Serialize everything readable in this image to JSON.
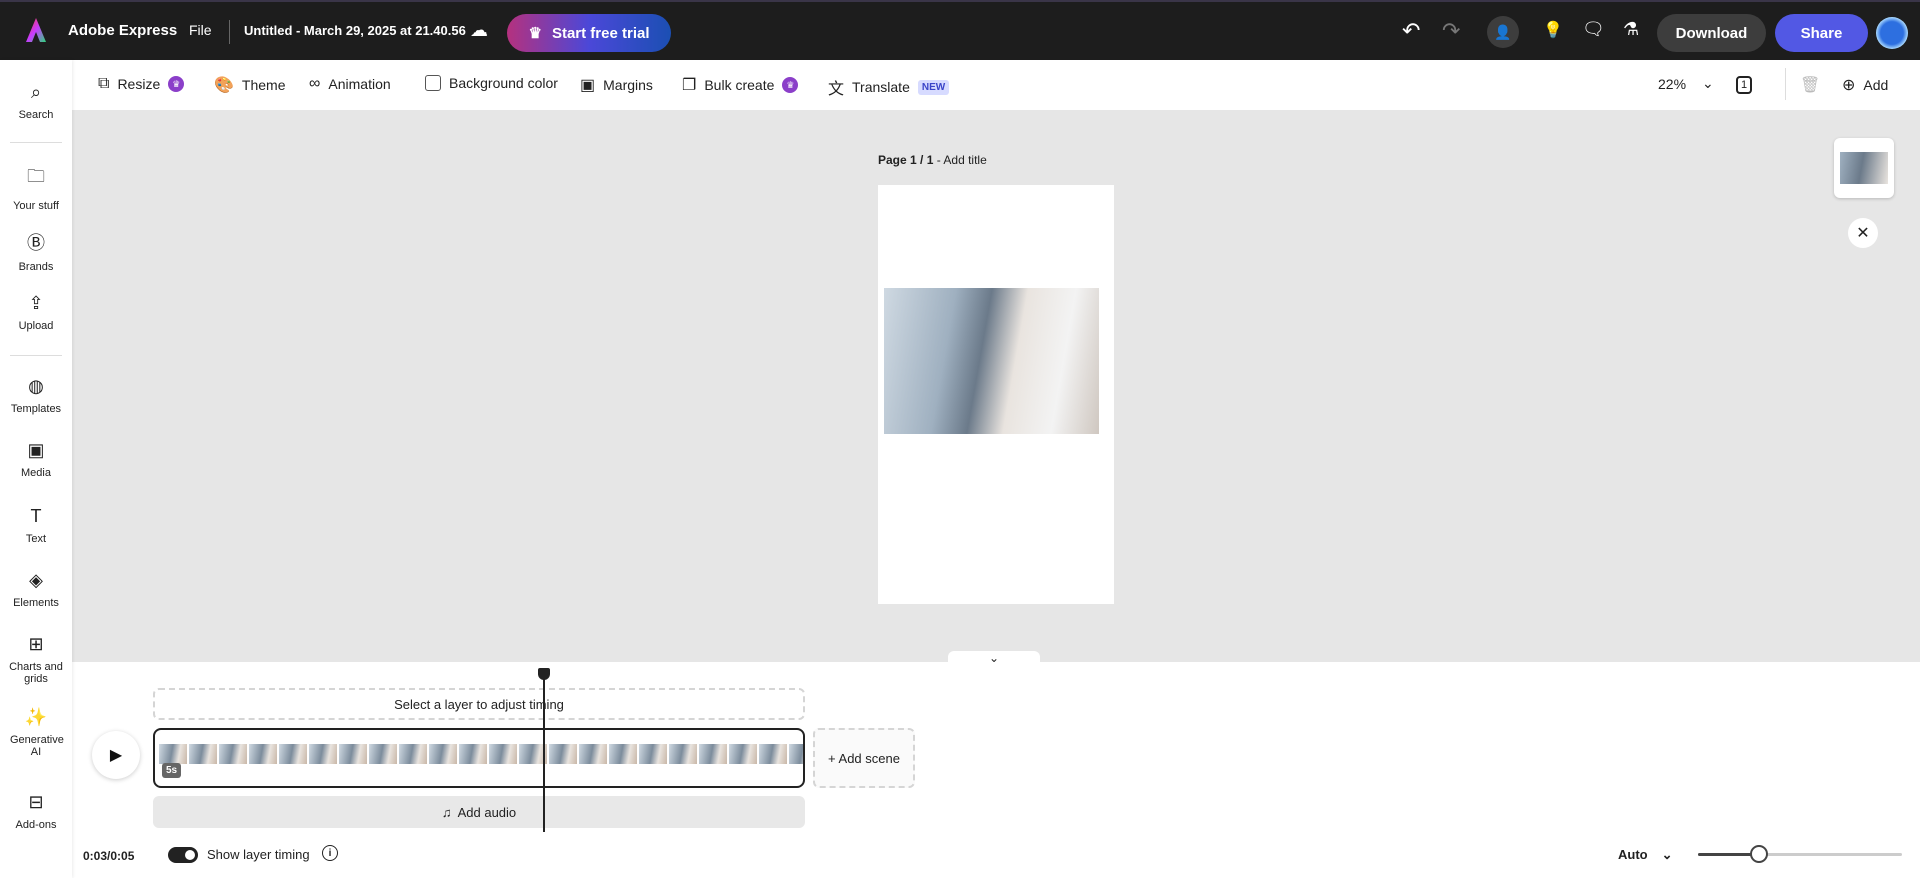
{
  "topbar": {
    "app_name": "Adobe Express",
    "file_menu": "File",
    "doc_title": "Untitled - March 29, 2025 at 21.40.56",
    "trial_label": "Start free trial",
    "download_label": "Download",
    "share_label": "Share"
  },
  "toolbar": {
    "items": [
      {
        "label": "Resize"
      },
      {
        "label": "Theme"
      },
      {
        "label": "Animation"
      },
      {
        "label": "Background color"
      },
      {
        "label": "Margins"
      },
      {
        "label": "Bulk create"
      },
      {
        "label": "Translate",
        "badge": "NEW"
      }
    ],
    "zoom": "22%",
    "page_count": "1",
    "add_label": "Add"
  },
  "sidebar": {
    "items": [
      {
        "label": "Search"
      },
      {
        "label": "Your stuff"
      },
      {
        "label": "Brands"
      },
      {
        "label": "Upload"
      },
      {
        "label": "Templates"
      },
      {
        "label": "Media"
      },
      {
        "label": "Text"
      },
      {
        "label": "Elements"
      },
      {
        "label": "Charts and grids"
      },
      {
        "label": "Generative AI"
      },
      {
        "label": "Add-ons"
      }
    ]
  },
  "canvas": {
    "page_label": "Page 1 / 1",
    "page_title_link": "- Add title"
  },
  "timeline": {
    "select_hint": "Select a layer to adjust timing",
    "scene_duration": "5s",
    "add_scene": "+ Add scene",
    "add_audio": "Add audio",
    "time": "0:03/0:05",
    "show_layer_timing": "Show layer timing",
    "playback_mode": "Auto",
    "zoom_fraction": 0.3
  }
}
